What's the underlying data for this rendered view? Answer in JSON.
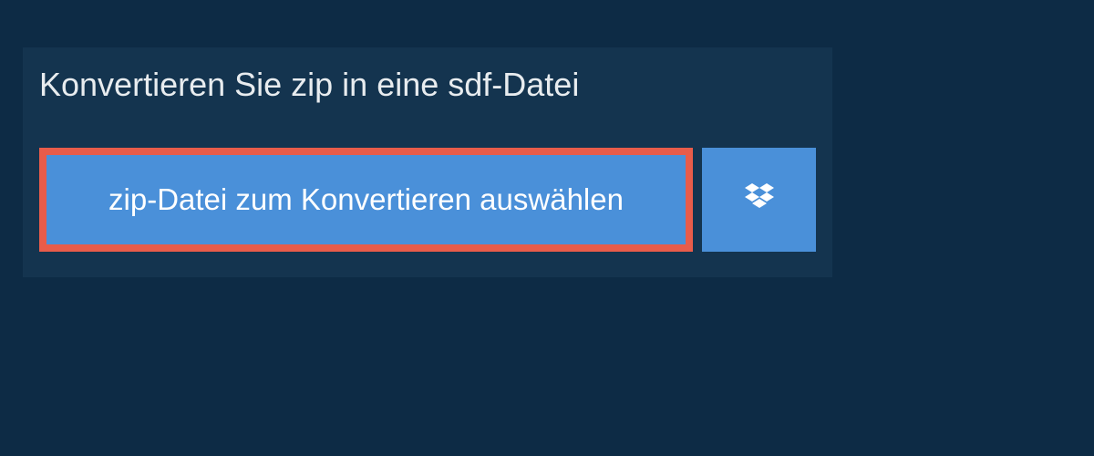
{
  "header": {
    "title": "Konvertieren Sie zip in eine sdf-Datei"
  },
  "actions": {
    "select_file_label": "zip-Datei zum Konvertieren auswählen"
  },
  "colors": {
    "background": "#0d2b45",
    "panel": "#14344f",
    "button": "#4a90d9",
    "highlight_border": "#e85c4a",
    "text_light": "#e8ecef",
    "text_white": "#ffffff"
  }
}
